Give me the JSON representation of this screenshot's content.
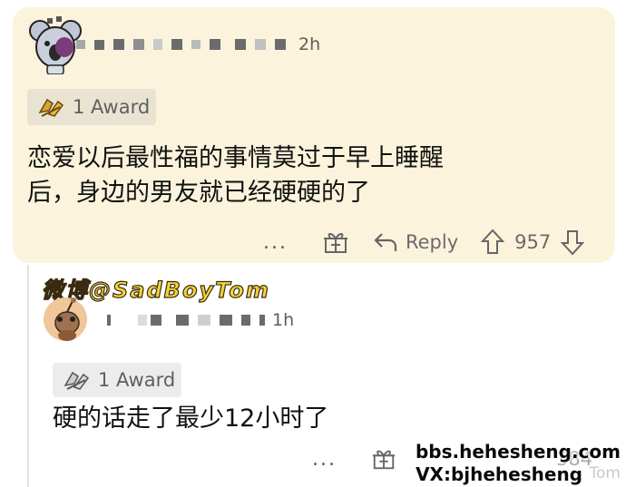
{
  "top_comment": {
    "time": "2h",
    "award_label": "1 Award",
    "text": "恋爱以后最性福的事情莫过于早上睡醒\n后，身边的男友就已经硬硬的了",
    "reply_label": "Reply",
    "vote_count": "957",
    "more_label": "..."
  },
  "reply_comment": {
    "time": "1h",
    "award_label": "1 Award",
    "text": "硬的话走了最少12小时了",
    "vote_count": "384",
    "more_label": "..."
  },
  "watermarks": {
    "weibo": "微博@SadBoyTom",
    "site": "bbs.hehesheng.com",
    "vx": "VX:bjhehesheng",
    "partial": "Tom"
  },
  "colors": {
    "highlight_bg": "#fbf3dc",
    "muted_text": "#6b6b6b",
    "award_chip_bg": "#e9e4d2"
  },
  "icons": {
    "award": "award-hands-icon",
    "gift": "gift-icon",
    "reply": "reply-arrow-icon",
    "upvote": "upvote-arrow-icon",
    "downvote": "downvote-arrow-icon"
  }
}
